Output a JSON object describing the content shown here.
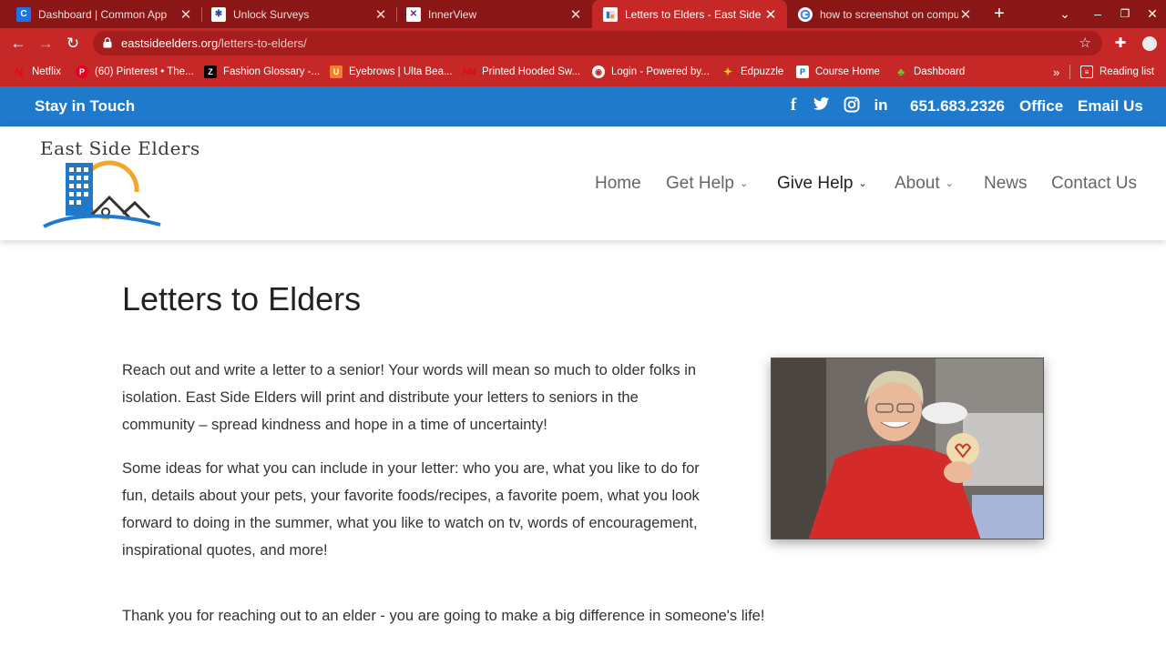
{
  "browser": {
    "tabs": [
      {
        "title": "Dashboard | Common App",
        "icon": "common-app-icon",
        "color": "#1a73e8"
      },
      {
        "title": "Unlock Surveys",
        "icon": "unlock-surveys-icon",
        "color": "#2b4fa3"
      },
      {
        "title": "InnerView",
        "icon": "innerview-icon",
        "color": "#5b2a86"
      },
      {
        "title": "Letters to Elders - East Side Elders",
        "icon": "east-side-elders-icon",
        "color": "#ffffff"
      },
      {
        "title": "how to screenshot on computer",
        "icon": "google-icon",
        "color": "#ffffff"
      }
    ],
    "url_domain": "eastsideelders.org",
    "url_path": "/letters-to-elders/",
    "bookmarks": [
      {
        "label": "Netflix",
        "icon": "netflix-icon"
      },
      {
        "label": "(60) Pinterest • The...",
        "icon": "pinterest-icon"
      },
      {
        "label": "Fashion Glossary -...",
        "icon": "zara-icon"
      },
      {
        "label": "Eyebrows | Ulta Bea...",
        "icon": "ulta-icon"
      },
      {
        "label": "Printed Hooded Sw...",
        "icon": "hm-icon"
      },
      {
        "label": "Login - Powered by...",
        "icon": "globe-icon"
      },
      {
        "label": "Edpuzzle",
        "icon": "edpuzzle-icon"
      },
      {
        "label": "Course Home",
        "icon": "pearson-icon"
      },
      {
        "label": "Dashboard",
        "icon": "dashboard-icon"
      }
    ],
    "more_bookmarks": "»",
    "reading_list": "Reading list"
  },
  "site": {
    "topbar": {
      "stay": "Stay in Touch",
      "phone": "651.683.2326",
      "office": "Office",
      "email": "Email Us"
    },
    "logo_text": "East Side Elders",
    "nav": [
      {
        "label": "Home",
        "dropdown": false
      },
      {
        "label": "Get Help",
        "dropdown": true
      },
      {
        "label": "Give Help",
        "dropdown": true
      },
      {
        "label": "About",
        "dropdown": true
      },
      {
        "label": "News",
        "dropdown": false
      },
      {
        "label": "Contact Us",
        "dropdown": false
      }
    ],
    "page_title": "Letters to Elders",
    "paragraphs": [
      "Reach out and write a letter to a senior!  Your words will mean so much to older folks in isolation.  East Side Elders will print and distribute your letters to seniors in the community – spread kindness and hope in a time of uncertainty!",
      "Some ideas for what you can include in your letter:  who you are, what you like to do for fun, details about your pets, your favorite foods/recipes, a favorite poem, what you look forward to doing in the summer, what you like to watch on tv, words of encouragement, inspirational quotes, and more!",
      "Thank you for reaching out to an elder - you are going to make a big difference in someone's life!"
    ],
    "colors": {
      "topbar": "#1f7acc",
      "browser_frame": "#c62828"
    }
  }
}
